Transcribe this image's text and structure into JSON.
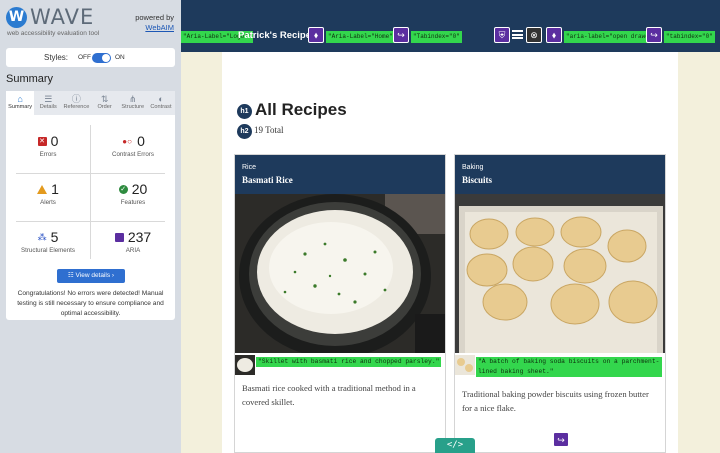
{
  "wave": {
    "logo_letter": "W",
    "logo_text": "WAVE",
    "tagline": "web accessibility evaluation tool",
    "powered_by": "powered by",
    "powered_link": "WebAIM",
    "styles_label": "Styles:",
    "styles_off": "OFF",
    "styles_on": "ON",
    "summary_title": "Summary",
    "tabs": [
      {
        "label": "Summary",
        "icon": "home-icon"
      },
      {
        "label": "Details",
        "icon": "list-icon"
      },
      {
        "label": "Reference",
        "icon": "info-icon"
      },
      {
        "label": "Order",
        "icon": "order-icon"
      },
      {
        "label": "Structure",
        "icon": "structure-icon"
      },
      {
        "label": "Contrast",
        "icon": "contrast-icon"
      }
    ],
    "stats": {
      "errors": {
        "value": "0",
        "label": "Errors"
      },
      "contrast_errors": {
        "value": "0",
        "label": "Contrast Errors"
      },
      "alerts": {
        "value": "1",
        "label": "Alerts"
      },
      "features": {
        "value": "20",
        "label": "Features"
      },
      "structural": {
        "value": "5",
        "label": "Structural Elements"
      },
      "aria": {
        "value": "237",
        "label": "ARIA"
      }
    },
    "view_details": "View details ›",
    "congrats": "Congratulations! No errors were detected! Manual testing is still necessary to ensure compliance and optimal accessibility.",
    "colors": {
      "accent": "#2f6fd0",
      "error": "#c62828",
      "alert": "#e39a1e",
      "feature": "#2e8b3f",
      "aria": "#5b2ea0",
      "badge": "#33d64d"
    }
  },
  "site": {
    "aria_logo": "\"Aria-Label=\"Logo\"\"",
    "title": "Patrick's Recipes",
    "aria_home": "\"Aria-Label=\"Home\"\"",
    "tabindex1": "\"Tabindex=\"0\"",
    "aria_drawer": "\"aria-label=\"open drawer\"\"",
    "tabindex2": "\"tabindex=\"0\"",
    "heading_badges": {
      "h1": "h1",
      "h2": "h2"
    },
    "page_title": "All Recipes",
    "total": "19 Total",
    "recipes": [
      {
        "category": "Rice",
        "name": "Basmati Rice",
        "alt": "\"Skillet with basmati rice and chopped parsley.\"",
        "description": "Basmati rice cooked with a traditional method in a covered skillet."
      },
      {
        "category": "Baking",
        "name": "Biscuits",
        "alt": "\"A batch of baking soda biscuits on a parchment-lined baking sheet.\"",
        "description": "Traditional baking powder biscuits using frozen butter for a nice flake."
      }
    ],
    "code_toggle": "</>"
  }
}
